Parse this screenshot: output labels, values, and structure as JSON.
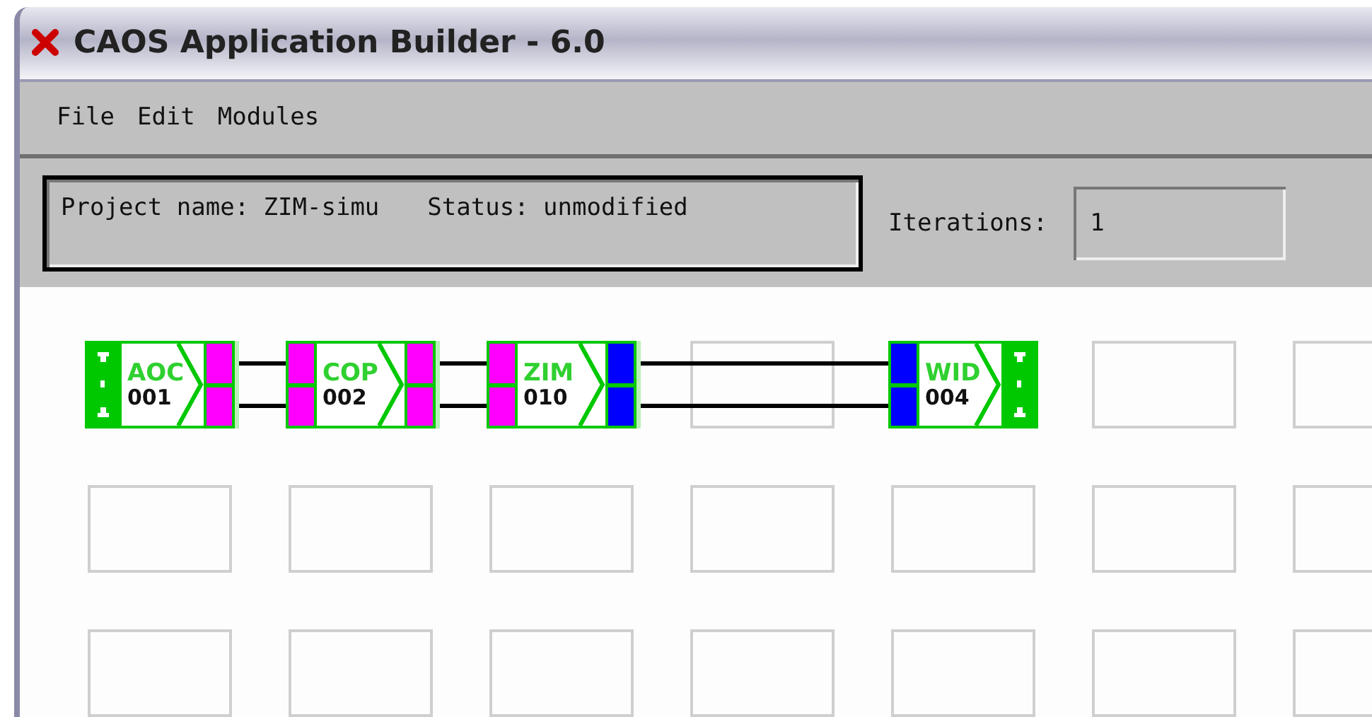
{
  "window": {
    "title": "CAOS Application Builder - 6.0"
  },
  "menu": [
    "File",
    "Edit",
    "Modules"
  ],
  "project": {
    "name": "Project name: ZIM-simu",
    "status": "Status: unmodified"
  },
  "iterations": {
    "label": "Iterations:",
    "value": "1"
  },
  "grid": {
    "rows": [
      [
        {
          "kind": "module",
          "name": "AOC",
          "number": "001",
          "wired_to_next": true,
          "left": {
            "kind": "terminal"
          },
          "right": {
            "kind": "ports",
            "ports": [
              {
                "color": "#ff00ff"
              },
              {
                "color": "#ff00ff"
              }
            ]
          }
        },
        {
          "kind": "module",
          "name": "COP",
          "number": "002",
          "wired_to_next": true,
          "left": {
            "kind": "ports",
            "ports": [
              {
                "color": "#ff00ff"
              },
              {
                "color": "#ff00ff"
              }
            ]
          },
          "right": {
            "kind": "ports",
            "ports": [
              {
                "color": "#ff00ff"
              },
              {
                "color": "#ff00ff"
              }
            ]
          }
        },
        {
          "kind": "module",
          "name": "ZIM",
          "number": "010",
          "wired_to_next": true,
          "left": {
            "kind": "ports",
            "ports": [
              {
                "color": "#ff00ff"
              },
              {
                "color": "#ff00ff"
              }
            ]
          },
          "right": {
            "kind": "ports",
            "ports": [
              {
                "color": "#0000ff"
              },
              {
                "color": "#0000ff"
              }
            ]
          }
        },
        {
          "kind": "empty"
        },
        {
          "kind": "module",
          "name": "WID",
          "number": "004",
          "wired_to_next": false,
          "left": {
            "kind": "ports",
            "ports": [
              {
                "color": "#0000ff"
              },
              {
                "color": "#0000ff"
              }
            ]
          },
          "right": {
            "kind": "terminal"
          }
        },
        {
          "kind": "empty"
        },
        {
          "kind": "empty"
        }
      ],
      [
        {
          "kind": "empty"
        },
        {
          "kind": "empty"
        },
        {
          "kind": "empty"
        },
        {
          "kind": "empty"
        },
        {
          "kind": "empty"
        },
        {
          "kind": "empty"
        },
        {
          "kind": "empty"
        }
      ],
      [
        {
          "kind": "empty"
        },
        {
          "kind": "empty"
        },
        {
          "kind": "empty"
        },
        {
          "kind": "empty"
        },
        {
          "kind": "empty"
        },
        {
          "kind": "empty"
        },
        {
          "kind": "empty"
        }
      ]
    ]
  }
}
